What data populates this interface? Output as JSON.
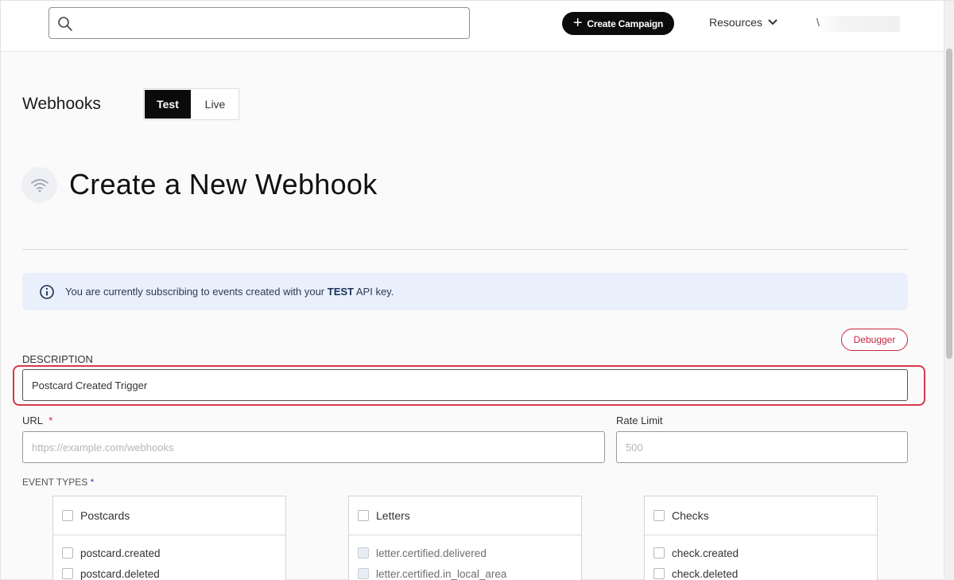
{
  "topbar": {
    "search_placeholder": "",
    "create_campaign_label": "Create Campaign",
    "resources_label": "Resources",
    "user_partial": "\\"
  },
  "header": {
    "page_heading": "Webhooks",
    "env_toggle": {
      "test_label": "Test",
      "live_label": "Live",
      "active": "Test"
    }
  },
  "title": "Create a New Webhook",
  "banner": {
    "text_before": "You are currently subscribing to events created with your ",
    "key_label": "TEST",
    "text_after": " API key."
  },
  "debugger_label": "Debugger",
  "form": {
    "description_label": "DESCRIPTION",
    "description_value": "Postcard Created Trigger",
    "url_label": "URL",
    "url_required_mark": "*",
    "url_placeholder": "https://example.com/webhooks",
    "rate_limit_label": "Rate Limit",
    "rate_limit_placeholder": "500",
    "event_types_label": "EVENT TYPES",
    "event_types_required_mark": "*"
  },
  "event_groups": [
    {
      "title": "Postcards",
      "items": [
        "postcard.created",
        "postcard.deleted"
      ],
      "disabled": false
    },
    {
      "title": "Letters",
      "items": [
        "letter.certified.delivered",
        "letter.certified.in_local_area"
      ],
      "disabled": true
    },
    {
      "title": "Checks",
      "items": [
        "check.created",
        "check.deleted"
      ],
      "disabled": false
    }
  ],
  "colors": {
    "accent_red": "#c8243f",
    "banner_bg": "#e9f0fb",
    "primary_black": "#0b0b0b"
  }
}
